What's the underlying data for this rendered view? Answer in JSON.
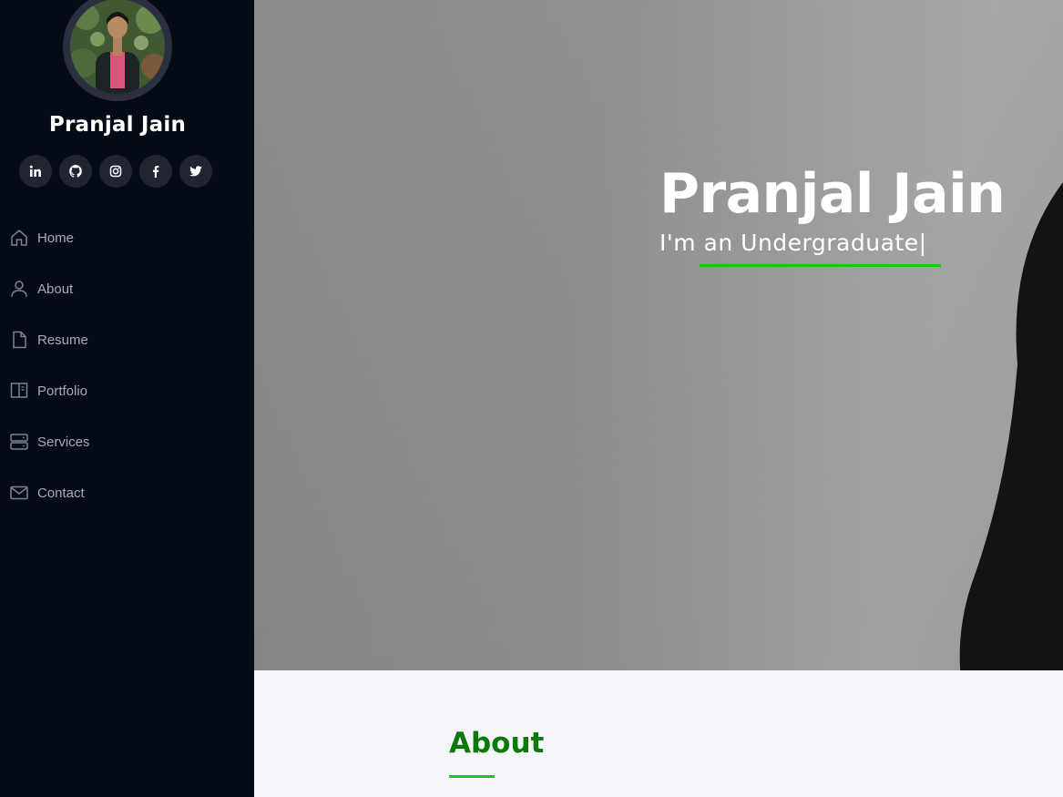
{
  "sidebar": {
    "profile_name": "Pranjal Jain",
    "socials": [
      {
        "icon": "linkedin-icon",
        "label": "LinkedIn"
      },
      {
        "icon": "github-icon",
        "label": "GitHub"
      },
      {
        "icon": "instagram-icon",
        "label": "Instagram"
      },
      {
        "icon": "facebook-icon",
        "label": "Facebook"
      },
      {
        "icon": "twitter-icon",
        "label": "Twitter"
      }
    ],
    "nav": [
      {
        "label": "Home",
        "icon": "house-icon"
      },
      {
        "label": "About",
        "icon": "person-icon"
      },
      {
        "label": "Resume",
        "icon": "file-icon"
      },
      {
        "label": "Portfolio",
        "icon": "book-icon"
      },
      {
        "label": "Services",
        "icon": "server-icon"
      },
      {
        "label": "Contact",
        "icon": "envelope-icon"
      }
    ]
  },
  "hero": {
    "title": "Pranjal Jain",
    "subtitle": "I'm an Undergraduate",
    "cursor": "|"
  },
  "about": {
    "title": "About"
  },
  "colors": {
    "sidebar_bg": "#040b14",
    "social_bg": "#212431",
    "nav_text": "#a8a9b4",
    "accent_green": "#18c818",
    "about_title": "#0b7a0b"
  }
}
